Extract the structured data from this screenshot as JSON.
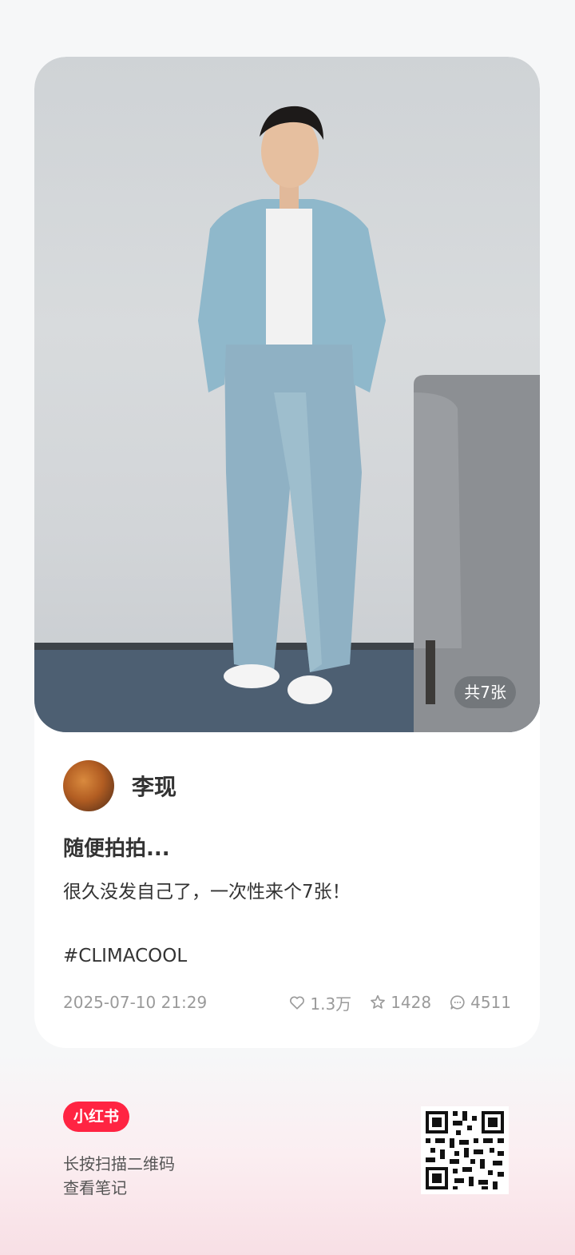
{
  "post": {
    "image_count_label": "共7张",
    "author_name": "李现",
    "title": "随便拍拍...",
    "description": "很久没发自己了，一次性来个7张！",
    "hashtag": "#CLIMACOOL",
    "timestamp": "2025-07-10 21:29",
    "likes": "1.3万",
    "favorites": "1428",
    "comments": "4511"
  },
  "footer": {
    "logo_text": "小红书",
    "line1": "长按扫描二维码",
    "line2": "查看笔记"
  },
  "icons": {
    "like": "heart-icon",
    "favorite": "star-icon",
    "comment": "comment-icon"
  },
  "colors": {
    "brand": "#ff2442",
    "text_primary": "#333333",
    "text_secondary": "#9a9a9a"
  }
}
